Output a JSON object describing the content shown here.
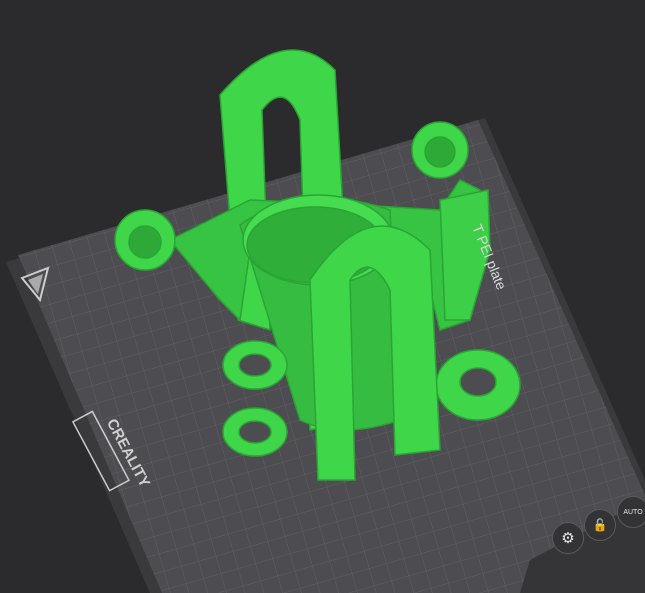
{
  "plate": {
    "type_label": "PEI plate",
    "type_label_prefix": "T",
    "brand": "CREALITY"
  },
  "controls": [
    {
      "name": "settings",
      "icon": "gear-icon",
      "glyph": "⚙"
    },
    {
      "name": "lock",
      "icon": "lock-icon",
      "glyph": "🔓"
    },
    {
      "name": "auto-arrange",
      "icon": "auto-orient-icon",
      "glyph": "AUTO"
    }
  ],
  "colors": {
    "background": "#2b2b2e",
    "plate": "#4e4e52",
    "grid": "#5f5f63",
    "model": "#3fd64a",
    "model_shade": "#2aa534"
  }
}
